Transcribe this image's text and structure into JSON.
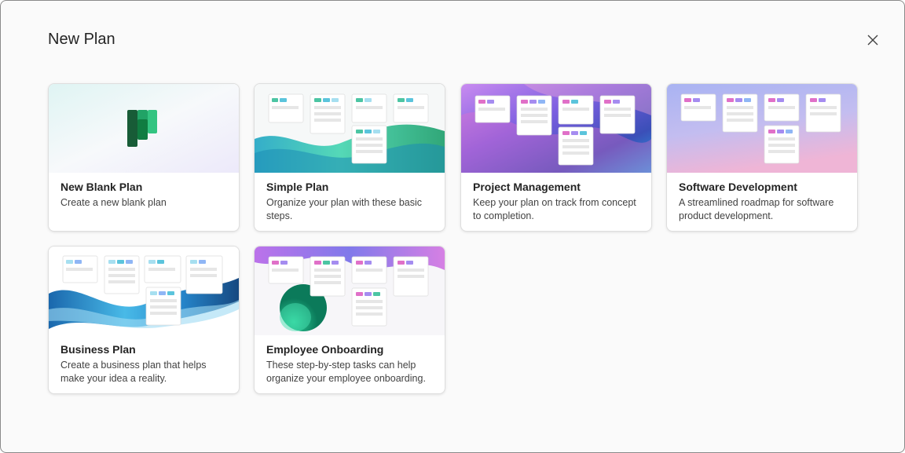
{
  "dialog": {
    "title": "New Plan",
    "close_icon": "close-icon"
  },
  "templates": [
    {
      "title": "New Blank Plan",
      "description": "Create a new blank plan"
    },
    {
      "title": "Simple Plan",
      "description": "Organize your plan with these basic steps."
    },
    {
      "title": "Project Management",
      "description": "Keep your plan on track from concept to completion."
    },
    {
      "title": "Software Development",
      "description": "A streamlined roadmap for software product development."
    },
    {
      "title": "Business Plan",
      "description": "Create a business plan that helps make your idea a reality."
    },
    {
      "title": "Employee Onboarding",
      "description": "These step-by-step tasks can help organize your employee onboarding."
    }
  ],
  "colors": {
    "planner_green": "#107c41",
    "card_border": "#dedede",
    "title_text": "#242424",
    "desc_text": "#424242"
  }
}
